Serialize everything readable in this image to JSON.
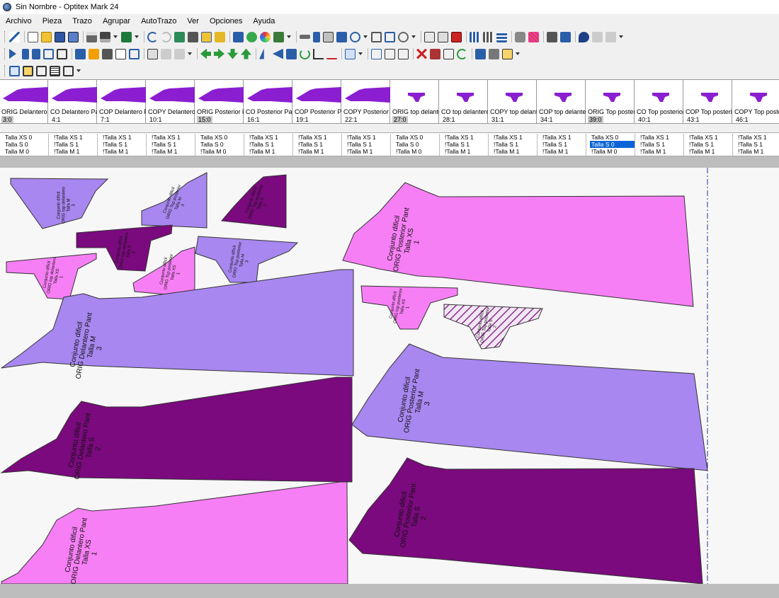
{
  "window": {
    "title": "Sin Nombre - Optitex Mark 24"
  },
  "menu": [
    "Archivo",
    "Pieza",
    "Trazo",
    "Agrupar",
    "AutoTrazo",
    "Ver",
    "Opciones",
    "Ayuda"
  ],
  "colors": {
    "dark": "#7a0a7d",
    "pink": "#f77ff5",
    "lavender": "#a887f0",
    "thumb": "#8a1ed0"
  },
  "thumbnails": [
    {
      "name": "ORIG Delantero Pant",
      "count": "3:0",
      "kind": "pant",
      "highlight": true
    },
    {
      "name": "CO  Delantero Pant",
      "count": "4:1",
      "kind": "pant"
    },
    {
      "name": "COP Delantero Pant",
      "count": "7:1",
      "kind": "pant"
    },
    {
      "name": "COPY Delantero Pant",
      "count": "10:1",
      "kind": "pant"
    },
    {
      "name": "ORIG Posterior Pant",
      "count": "15:0",
      "kind": "pant",
      "highlight": true
    },
    {
      "name": "CO Posterior Pant_",
      "count": "16:1",
      "kind": "pant"
    },
    {
      "name": "COP Posterior Pant",
      "count": "19:1",
      "kind": "pant"
    },
    {
      "name": "COPY Posterior Pant",
      "count": "22:1",
      "kind": "pant"
    },
    {
      "name": "ORIG top delantero",
      "count": "27:0",
      "kind": "top",
      "highlight": true
    },
    {
      "name": "CO top delantero_",
      "count": "28:1",
      "kind": "top"
    },
    {
      "name": "COPY  top delantero",
      "count": "31:1",
      "kind": "top"
    },
    {
      "name": "COP top delantero",
      "count": "34:1",
      "kind": "top"
    },
    {
      "name": "ORIG Top posterior",
      "count": "39:0",
      "kind": "top",
      "highlight": true
    },
    {
      "name": "CO Top posterior_",
      "count": "40:1",
      "kind": "top"
    },
    {
      "name": "COP Top posterior",
      "count": "43:1",
      "kind": "top"
    },
    {
      "name": "COPY Top posterior",
      "count": "46:1",
      "kind": "top"
    }
  ],
  "sizes": [
    [
      "Talla XS 0",
      "Talla S 0",
      "Talla M 0"
    ],
    [
      "!Talla XS 1",
      "!Talla S 1",
      "!Talla M 1"
    ],
    [
      "!Talla XS 1",
      "!Talla S 1",
      "!Talla M 1"
    ],
    [
      "!Talla XS 1",
      "!Talla S 1",
      "!Talla M 1"
    ],
    [
      "Talla XS 0",
      "Talla S 0",
      "!Talla M 0"
    ],
    [
      "!Talla XS 1",
      "!Talla S 1",
      "!Talla M 1"
    ],
    [
      "!Talla XS 1",
      "!Talla S 1",
      "!Talla M 1"
    ],
    [
      "!Talla XS 1",
      "!Talla S 1",
      "!Talla M 1"
    ],
    [
      "Talla XS 0",
      "Talla S 0",
      "!Talla M 0"
    ],
    [
      "!Talla XS 1",
      "!Talla S 1",
      "!Talla M 1"
    ],
    [
      "!Talla XS 1",
      "!Talla S 1",
      "!Talla M 1"
    ],
    [
      "!Talla XS 1",
      "!Talla S 1",
      "!Talla M 1"
    ],
    [
      "Talla XS 0",
      "Talla S 0",
      "!Talla M 0"
    ],
    [
      "!Talla XS 1",
      "!Talla S 1",
      "!Talla M 1"
    ],
    [
      "!Talla XS 1",
      "!Talla S 1",
      "!Talla M 1"
    ],
    [
      "!Talla XS 1",
      "!Talla S 1",
      "!Talla M 1"
    ]
  ],
  "selected_size": {
    "column": 12,
    "row": 1
  },
  "pieces": [
    {
      "id": "p1",
      "lines": [
        "Conjunto dificil",
        "ORIG top delantero",
        "Talla M",
        "3"
      ],
      "color": "lavender"
    },
    {
      "id": "p2",
      "lines": [
        "Conjunto dificil",
        "ORIG Top posterior",
        "Talla M",
        "3"
      ],
      "color": "lavender"
    },
    {
      "id": "p3",
      "lines": [
        "Conjunto dificil",
        "ORIG Top posterior",
        "Talla S",
        "2"
      ],
      "color": "dark"
    },
    {
      "id": "p4",
      "lines": [
        "Conjunto dificil",
        "ORIG top delantero",
        "Talla S",
        "2"
      ],
      "color": "dark"
    },
    {
      "id": "p5",
      "lines": [
        "Conjunto dificil",
        "ORIG top delantero",
        "Talla XS",
        "1"
      ],
      "color": "pink"
    },
    {
      "id": "p6",
      "lines": [
        "Conjunto dificil",
        "ORIG Top posterior",
        "Talla XS",
        "1"
      ],
      "color": "pink"
    },
    {
      "id": "p7",
      "lines": [
        "Conjunto dificil",
        "ORIG Top posterior",
        "Talla M",
        "3"
      ],
      "color": "lavender"
    },
    {
      "id": "p8",
      "lines": [
        "Conjunto dificil",
        "ORIG Posterior Pant",
        "Talla XS",
        "1"
      ],
      "color": "pink"
    },
    {
      "id": "p9",
      "lines": [
        "Conjunto dificil",
        "ORIG Delantero Pant",
        "Talla M",
        "3"
      ],
      "color": "lavender"
    },
    {
      "id": "p10",
      "lines": [
        "Conjunto dificil",
        "ORIG top posterior",
        "Talla XS",
        "1"
      ],
      "color": "pink"
    },
    {
      "id": "p11",
      "lines": [
        "Conjunto dificil",
        "ORIG Top posterior",
        "Talla S",
        "2"
      ],
      "color": "hatched"
    },
    {
      "id": "p12",
      "lines": [
        "Conjunto dificil",
        "ORIG Posterior Pant",
        "Talla M",
        "3"
      ],
      "color": "lavender"
    },
    {
      "id": "p13",
      "lines": [
        "Conjunto dificil",
        "ORIG Delantero Pant",
        "Talla S",
        "2"
      ],
      "color": "dark"
    },
    {
      "id": "p14",
      "lines": [
        "Conjunto dificil",
        "ORIG Posterior Pant",
        "Talla S",
        "2"
      ],
      "color": "dark"
    },
    {
      "id": "p15",
      "lines": [
        "Conjunto dificil",
        "ORIG Delantero Pant",
        "Talla XS",
        "1"
      ],
      "color": "pink"
    }
  ]
}
